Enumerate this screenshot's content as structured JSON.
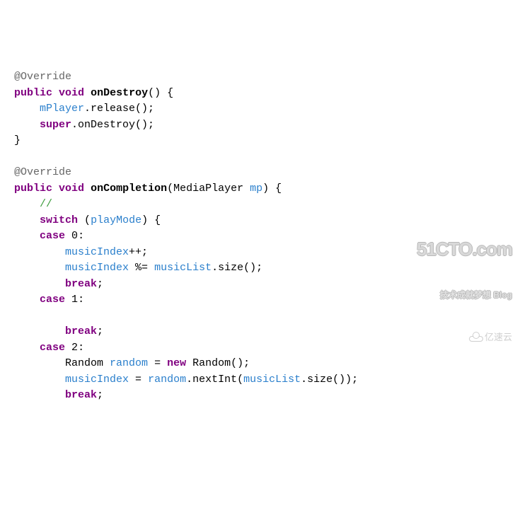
{
  "code": {
    "annotation1": "@Override",
    "pub1": "public",
    "void1": "void",
    "onDestroy": "onDestroy",
    "mPlayer": "mPlayer",
    "release": ".release();",
    "super": "super",
    "dotOnDestroy": ".onDestroy();",
    "annotation2": "@Override",
    "pub2": "public",
    "void2": "void",
    "onCompletion": "onCompletion",
    "mpType": "MediaPlayer",
    "mpVar": "mp",
    "comment": "//",
    "switch": "switch",
    "playMode": "playMode",
    "case": "case",
    "c0": "0",
    "c1": "1",
    "c2": "2",
    "musicIndex": "musicIndex",
    "musicList": "musicList",
    "size": ".size();",
    "break": "break",
    "random": "random",
    "RandomType": "Random",
    "new": "new",
    "nextInt": ".nextInt(",
    "sizeCall": ".size());"
  },
  "watermark": {
    "line1": "51CTO.com",
    "line2": "技术成就梦想  Blog",
    "line3": "亿速云"
  }
}
